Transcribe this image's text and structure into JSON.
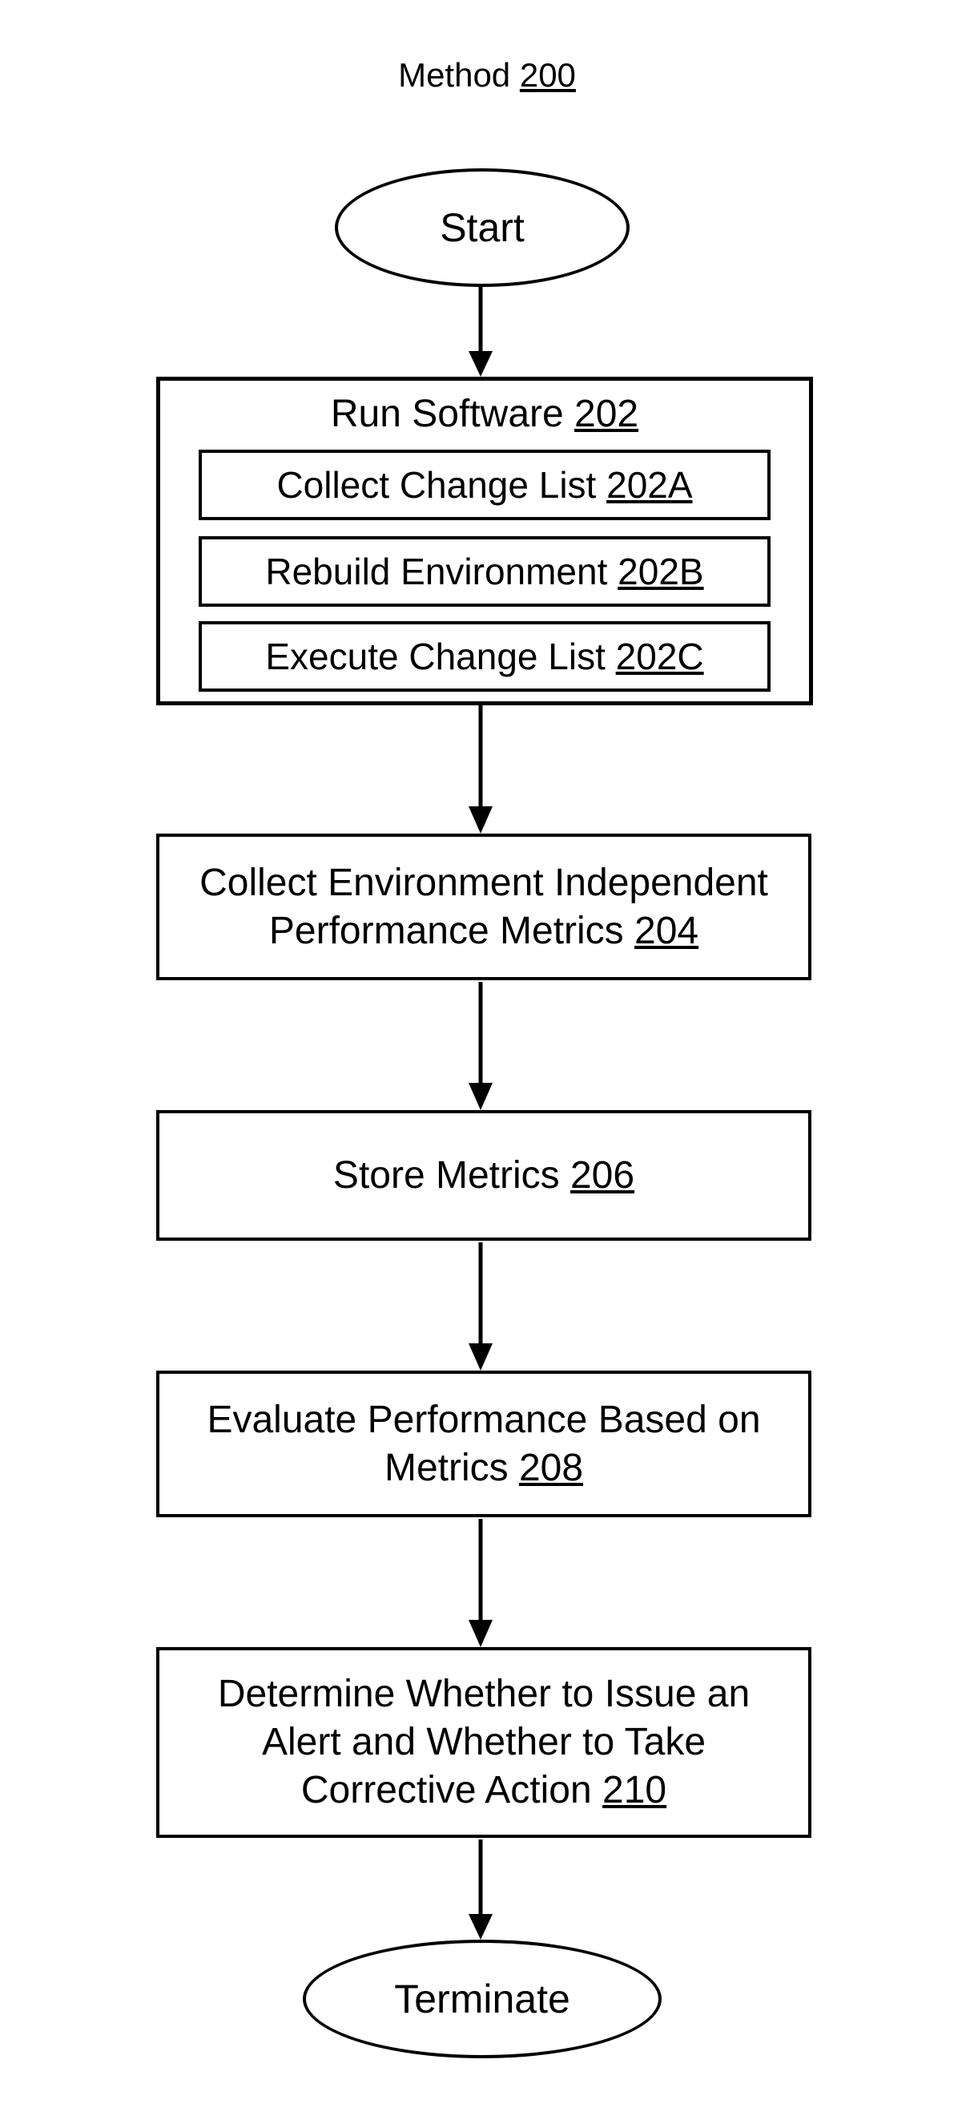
{
  "chart_data": {
    "type": "flowchart",
    "title": "Method 200",
    "nodes": [
      {
        "id": "start",
        "type": "terminator",
        "label": "Start"
      },
      {
        "id": "202",
        "type": "process-group",
        "label": "Run Software",
        "ref": "202",
        "children": [
          {
            "id": "202A",
            "label": "Collect Change List",
            "ref": "202A"
          },
          {
            "id": "202B",
            "label": "Rebuild Environment",
            "ref": "202B"
          },
          {
            "id": "202C",
            "label": "Execute Change List",
            "ref": "202C"
          }
        ]
      },
      {
        "id": "204",
        "type": "process",
        "label": "Collect Environment Independent Performance Metrics",
        "ref": "204"
      },
      {
        "id": "206",
        "type": "process",
        "label": "Store Metrics",
        "ref": "206"
      },
      {
        "id": "208",
        "type": "process",
        "label": "Evaluate Performance Based on Metrics",
        "ref": "208"
      },
      {
        "id": "210",
        "type": "process",
        "label": "Determine Whether to Issue an Alert and Whether to Take Corrective Action",
        "ref": "210"
      },
      {
        "id": "terminate",
        "type": "terminator",
        "label": "Terminate"
      }
    ],
    "edges": [
      [
        "start",
        "202"
      ],
      [
        "202",
        "204"
      ],
      [
        "204",
        "206"
      ],
      [
        "206",
        "208"
      ],
      [
        "208",
        "210"
      ],
      [
        "210",
        "terminate"
      ]
    ]
  },
  "title_prefix": "Method ",
  "title_ref": "200",
  "start_label": "Start",
  "terminate_label": "Terminate",
  "step202": {
    "label": "Run Software ",
    "ref": "202"
  },
  "step202A": {
    "label": "Collect Change List ",
    "ref": "202A"
  },
  "step202B": {
    "label": "Rebuild Environment ",
    "ref": "202B"
  },
  "step202C": {
    "label": "Execute Change List ",
    "ref": "202C"
  },
  "step204": {
    "label_l1": "Collect Environment Independent",
    "label_l2": "Performance Metrics ",
    "ref": "204"
  },
  "step206": {
    "label": "Store Metrics ",
    "ref": "206"
  },
  "step208": {
    "label_l1": "Evaluate Performance Based on",
    "label_l2": "Metrics ",
    "ref": "208"
  },
  "step210": {
    "label_l1": "Determine Whether to Issue an",
    "label_l2": "Alert and Whether to Take",
    "label_l3": "Corrective Action ",
    "ref": "210"
  }
}
